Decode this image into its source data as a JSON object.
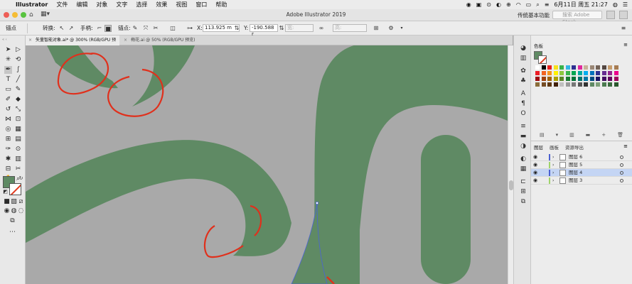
{
  "menubar": {
    "apple": "",
    "app": "Illustrator",
    "items": [
      "文件",
      "编辑",
      "对象",
      "文字",
      "选择",
      "效果",
      "视图",
      "窗口",
      "帮助"
    ],
    "datetime": "6月11日 周五 21:27"
  },
  "window": {
    "title": "Adobe Illustrator 2019",
    "workspace": "传统基本功能",
    "search_placeholder": "搜索 Adobe Stock"
  },
  "controlbar": {
    "anchor_label": "锚点",
    "convert_label": "转换:",
    "handles_label": "手柄:",
    "anchors_label": "锚点:",
    "x_label": "X:",
    "x_value": "113.925 m",
    "y_label": "Y:",
    "y_value": "-190.588 r",
    "w_label": "宽:",
    "h_label": "高:"
  },
  "tabs": [
    {
      "label": "矢量智能对象.ai* @ 300% (RGB/GPU 预览)",
      "active": true
    },
    {
      "label": "梅花.ai @ 50% (RGB/GPU 预览)",
      "active": false
    }
  ],
  "swatches_panel": {
    "title": "色板",
    "colors": {
      "fill": "#5f8a64",
      "stroke": "#e03a1e"
    }
  },
  "layers_panel": {
    "tabs": [
      "图层",
      "画板",
      "资源导出"
    ],
    "layers": [
      {
        "name": "图层 6",
        "color": "#4a5fd0",
        "selected": false
      },
      {
        "name": "图层 5",
        "color": "#9fd46a",
        "selected": false
      },
      {
        "name": "图层 4",
        "color": "#4a5fd0",
        "selected": true
      },
      {
        "name": "图层 3",
        "color": "#9fd46a",
        "selected": false
      }
    ]
  },
  "canvas": {
    "shape_color": "#5f8a64",
    "background": "#a9a9a9",
    "annotation_color": "#e0301c"
  }
}
